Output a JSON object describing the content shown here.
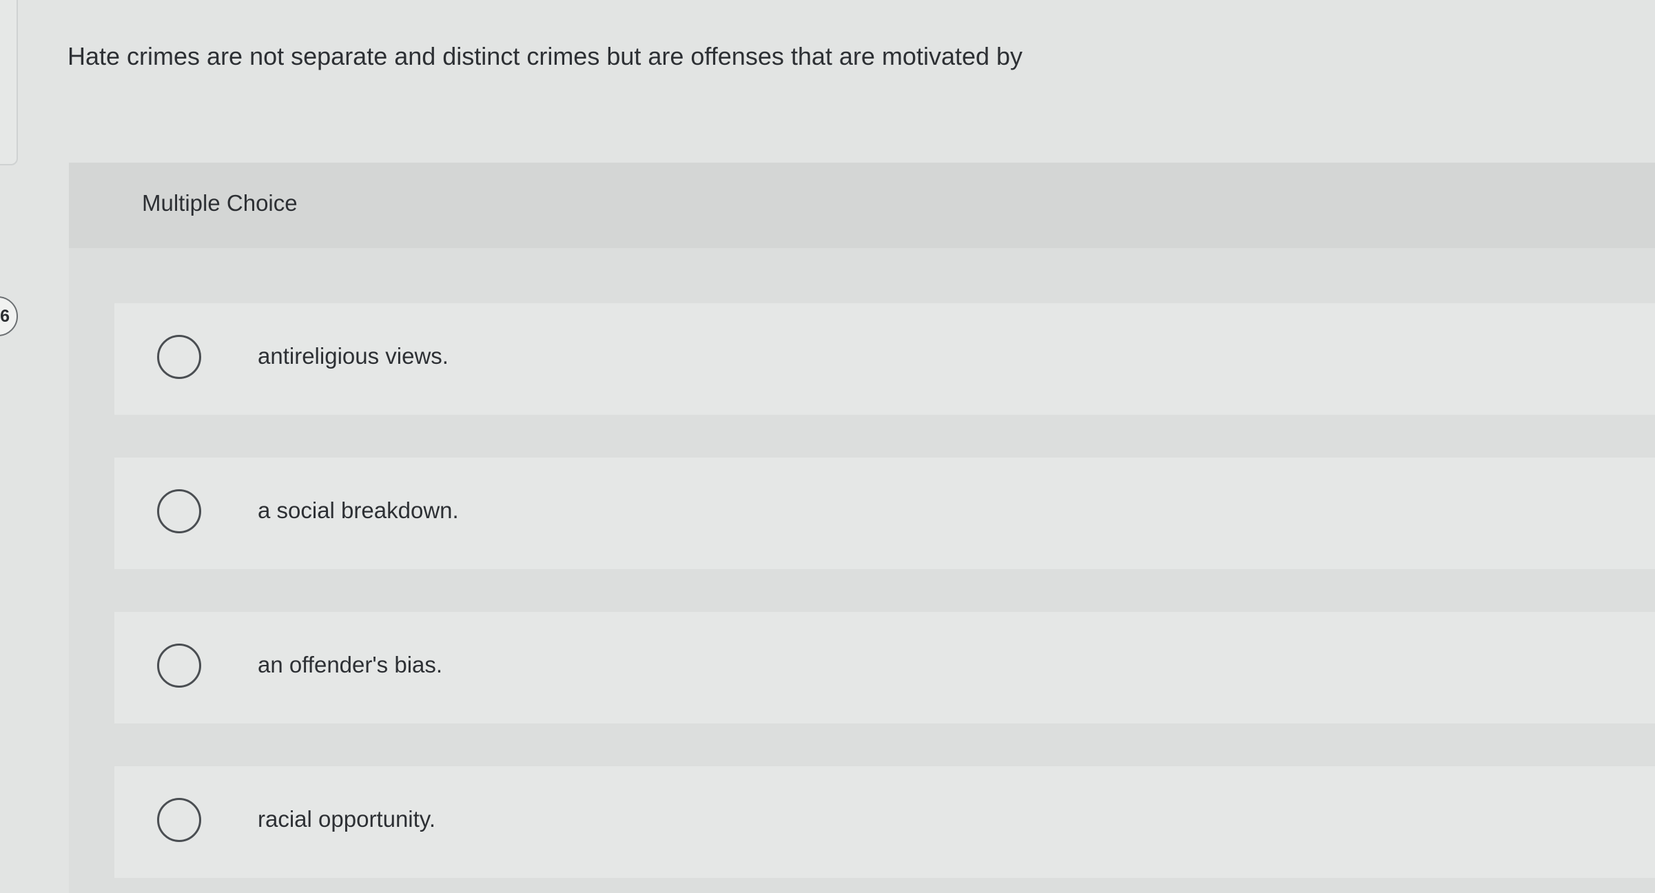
{
  "sidebar": {
    "question_number": "6"
  },
  "question": {
    "prompt": "Hate crimes are not separate and distinct crimes but are offenses that are motivated by"
  },
  "answer_block": {
    "type_label": "Multiple Choice",
    "options": [
      {
        "label": "antireligious views.",
        "selected": false
      },
      {
        "label": "a social breakdown.",
        "selected": false
      },
      {
        "label": "an offender's bias.",
        "selected": false
      },
      {
        "label": "racial opportunity.",
        "selected": false
      }
    ]
  }
}
